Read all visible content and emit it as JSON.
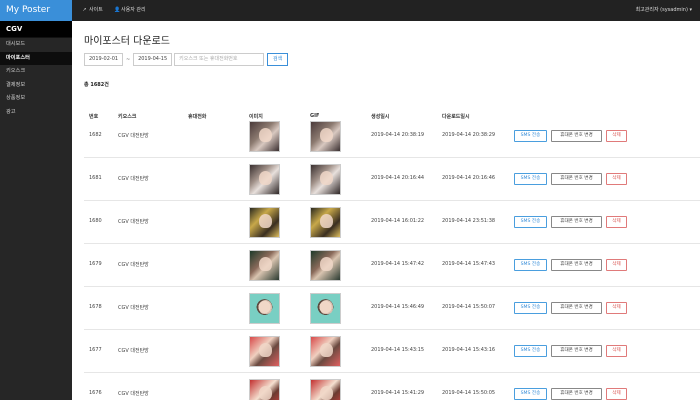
{
  "app": {
    "title": "My Poster",
    "client": "CGV"
  },
  "sidebar": {
    "items": [
      {
        "label": "대시보드",
        "active": false
      },
      {
        "label": "마이포스터",
        "active": true
      },
      {
        "label": "키오스크",
        "active": false
      },
      {
        "label": "결제정보",
        "active": false
      },
      {
        "label": "상품정보",
        "active": false
      },
      {
        "label": "광고",
        "active": false
      }
    ]
  },
  "topbar": {
    "links": [
      {
        "label": "사이트",
        "icon": "external-link-icon"
      },
      {
        "label": "사용자 관리",
        "icon": "user-icon"
      }
    ],
    "user": "최고관리자 (sysadmin) ▾"
  },
  "main": {
    "title": "마이포스터 다운로드",
    "filter": {
      "date_from": "2019-02-01",
      "separator": "~",
      "date_to": "2019-04-15",
      "search_placeholder": "키오스크 또는 휴대전화번호",
      "search_button": "검색"
    },
    "total": "총 1682건"
  },
  "table": {
    "headers": [
      "번호",
      "키오스크",
      "휴대전화",
      "이미지",
      "GIF",
      "생성일시",
      "다운로드일시"
    ],
    "actions": {
      "sms": "SMS 전송",
      "phone": "휴대폰 번호 변경",
      "delete": "삭제"
    },
    "rows": [
      {
        "no": "1682",
        "kiosk": "CGV 대전탄방",
        "phone": "",
        "created": "2019-04-14 20:38:19",
        "downloaded": "2019-04-14 20:38:29",
        "thumb": "t-dark"
      },
      {
        "no": "1681",
        "kiosk": "CGV 대전탄방",
        "phone": "",
        "created": "2019-04-14 20:16:44",
        "downloaded": "2019-04-14 20:16:46",
        "thumb": "t-photo"
      },
      {
        "no": "1680",
        "kiosk": "CGV 대전탄방",
        "phone": "",
        "created": "2019-04-14 16:01:22",
        "downloaded": "2019-04-14 23:51:38",
        "thumb": "t-gold"
      },
      {
        "no": "1679",
        "kiosk": "CGV 대전탄방",
        "phone": "",
        "created": "2019-04-14 15:47:42",
        "downloaded": "2019-04-14 15:47:43",
        "thumb": "t-green"
      },
      {
        "no": "1678",
        "kiosk": "CGV 대전탄방",
        "phone": "",
        "created": "2019-04-14 15:46:49",
        "downloaded": "2019-04-14 15:50:07",
        "thumb": "t-mint"
      },
      {
        "no": "1677",
        "kiosk": "CGV 대전탄방",
        "phone": "",
        "created": "2019-04-14 15:43:15",
        "downloaded": "2019-04-14 15:43:16",
        "thumb": "t-red"
      },
      {
        "no": "1676",
        "kiosk": "CGV 대전탄방",
        "phone": "",
        "created": "2019-04-14 15:41:29",
        "downloaded": "2019-04-14 15:50:05",
        "thumb": "t-straw"
      }
    ]
  }
}
